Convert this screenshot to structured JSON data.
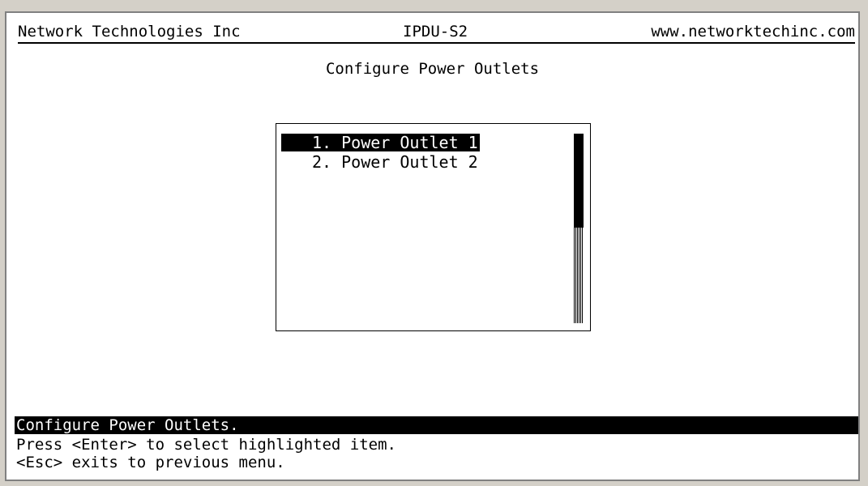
{
  "header": {
    "company": "Network Technologies Inc",
    "model": "IPDU-S2",
    "website": "www.networktechinc.com"
  },
  "page_title": "Configure Power Outlets",
  "menu": {
    "items": [
      {
        "label": "1. Power Outlet 1",
        "selected": true
      },
      {
        "label": "2. Power Outlet 2",
        "selected": false
      }
    ]
  },
  "footer": {
    "status": "Configure Power Outlets.",
    "help_lines": [
      "Press <Enter> to select highlighted item.",
      "<Esc> exits to previous menu."
    ]
  },
  "colors": {
    "background": "#ffffff",
    "text": "#000000",
    "highlight": "#000000",
    "window_frame": "#d4d0c8"
  }
}
